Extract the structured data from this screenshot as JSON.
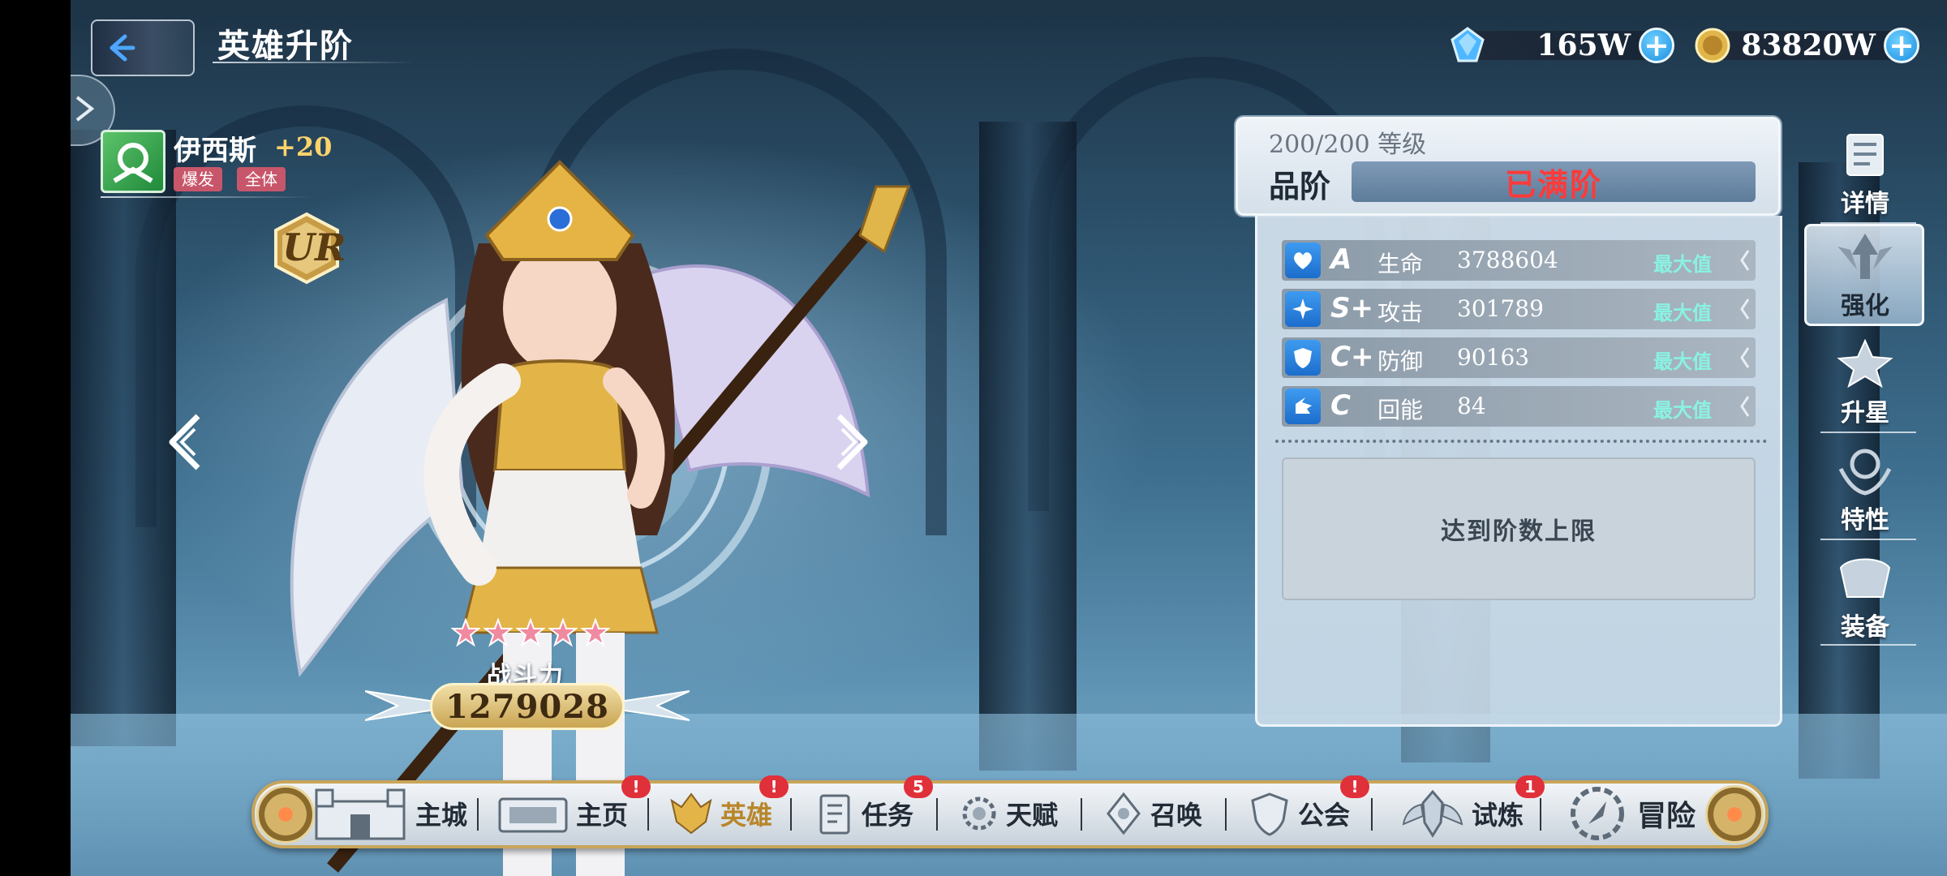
{
  "header": {
    "title": "英雄升阶",
    "currency": [
      {
        "icon": "diamond-icon",
        "value": "165W"
      },
      {
        "icon": "gold-coin-icon",
        "value": "83820W"
      }
    ]
  },
  "hero": {
    "name": "伊西斯",
    "plus": "+20",
    "tags": [
      "爆发",
      "全体"
    ],
    "rarity": "UR",
    "stars": 5,
    "power_label": "战斗力",
    "power_value": "1279028"
  },
  "panel": {
    "level": "200/200 等级",
    "grade_label": "品阶",
    "grade_value": "已满阶",
    "stats": [
      {
        "icon": "heart-icon",
        "grade": "A",
        "name": "生命",
        "value": "3788604",
        "status": "最大值"
      },
      {
        "icon": "shuriken-icon",
        "grade": "S+",
        "name": "攻击",
        "value": "301789",
        "status": "最大值"
      },
      {
        "icon": "shield-icon",
        "grade": "C+",
        "name": "防御",
        "value": "90163",
        "status": "最大值"
      },
      {
        "icon": "energy-icon",
        "grade": "C",
        "name": "回能",
        "value": "84",
        "status": "最大值"
      }
    ],
    "limit_text": "达到阶数上限"
  },
  "side_nav": [
    {
      "label": "详情",
      "active": false
    },
    {
      "label": "强化",
      "active": true
    },
    {
      "label": "升星",
      "active": false
    },
    {
      "label": "特性",
      "active": false
    },
    {
      "label": "装备",
      "active": false
    }
  ],
  "bottom_nav": [
    {
      "label": "主城",
      "badge": ""
    },
    {
      "label": "主页",
      "badge": "!"
    },
    {
      "label": "英雄",
      "badge": "!"
    },
    {
      "label": "任务",
      "badge": "5"
    },
    {
      "label": "天赋",
      "badge": ""
    },
    {
      "label": "召唤",
      "badge": ""
    },
    {
      "label": "公会",
      "badge": "!"
    },
    {
      "label": "试炼",
      "badge": "1"
    },
    {
      "label": "冒险",
      "badge": ""
    }
  ],
  "colors": {
    "accent_blue": "#1c6dcc",
    "max_text": "#8af2e2",
    "grade_red": "#ff3a3a",
    "badge_red": "#e0303a",
    "gold_trim": "#c7a55a"
  }
}
